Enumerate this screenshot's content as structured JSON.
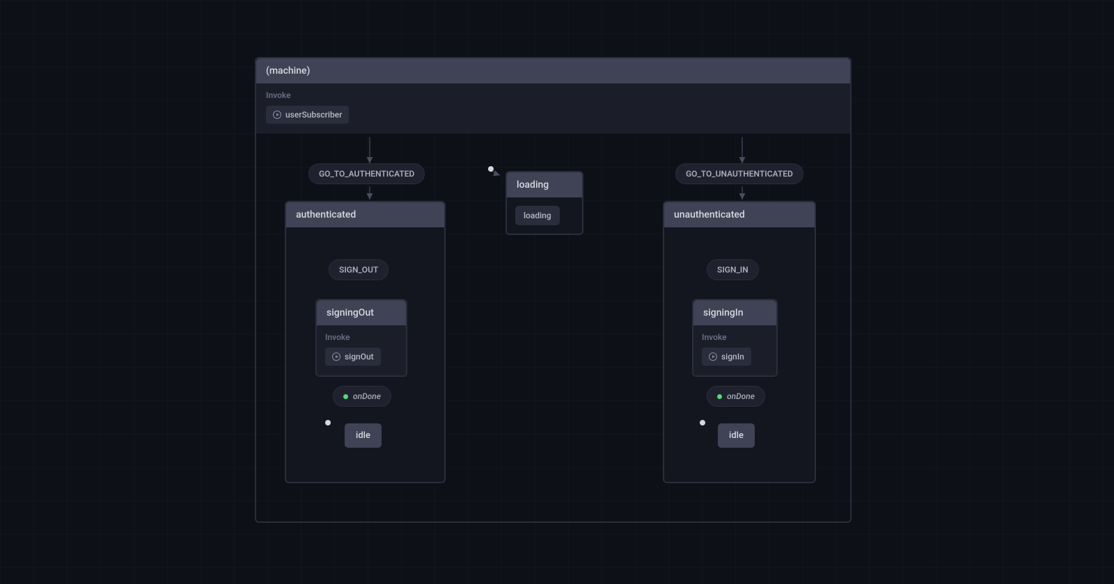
{
  "root": {
    "title": "(machine)",
    "invokeLabel": "Invoke",
    "invokeService": "userSubscriber"
  },
  "events": {
    "goAuth": "GO_TO_AUTHENTICATED",
    "goUnauth": "GO_TO_UNAUTHENTICATED",
    "signOut": "SIGN_OUT",
    "signIn": "SIGN_IN",
    "onDone1": "onDone",
    "onDone2": "onDone"
  },
  "states": {
    "authenticated": "authenticated",
    "unauthenticated": "unauthenticated",
    "loading": "loading",
    "loadingChip": "loading",
    "signingOut": "signingOut",
    "signingIn": "signingIn",
    "idle1": "idle",
    "idle2": "idle"
  },
  "invokes": {
    "label1": "Invoke",
    "signOut": "signOut",
    "label2": "Invoke",
    "signIn": "signIn"
  }
}
